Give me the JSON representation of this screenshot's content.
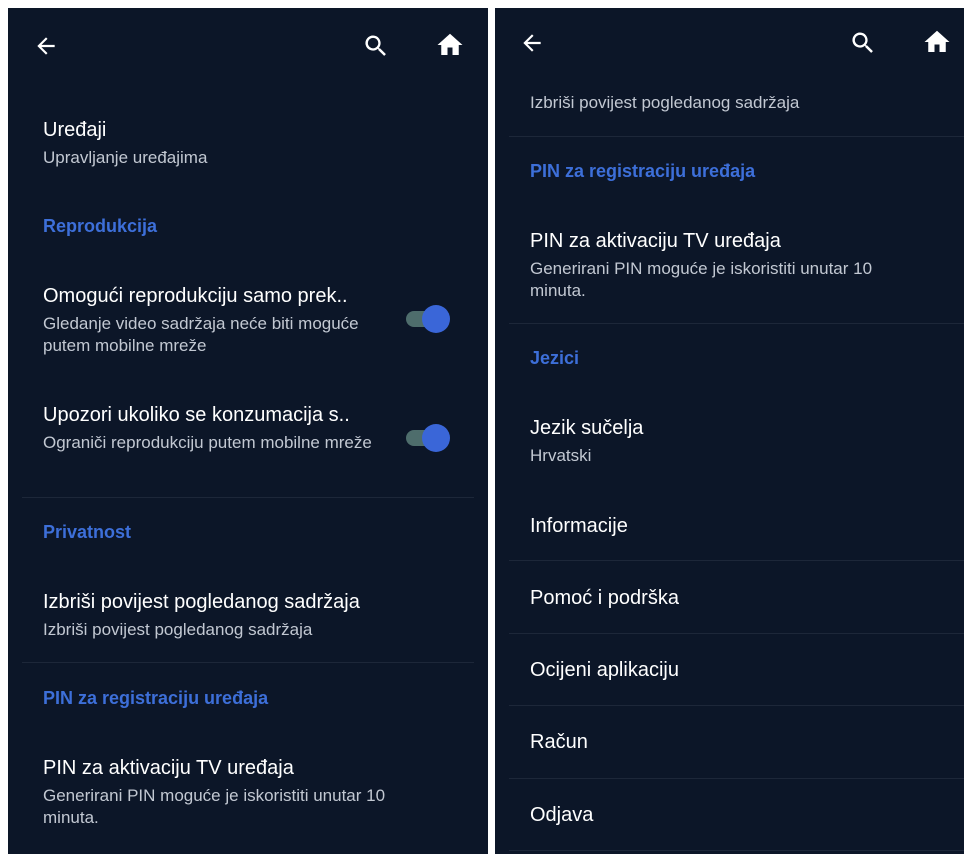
{
  "left": {
    "devices": {
      "title": "Uređaji",
      "subtitle": "Upravljanje uređajima"
    },
    "section_playback": "Reprodukcija",
    "wifi_only": {
      "title": "Omogući reprodukciju samo prek..",
      "subtitle": "Gledanje video sadržaja neće biti moguće putem mobilne mreže",
      "enabled": true
    },
    "warn_consumption": {
      "title": "Upozori ukoliko se konzumacija s..",
      "subtitle": "Ograniči reprodukciju putem mobilne mreže",
      "enabled": true
    },
    "section_privacy": "Privatnost",
    "clear_history": {
      "title": "Izbriši povijest pogledanog sadržaja",
      "subtitle": "Izbriši povijest pogledanog sadržaja"
    },
    "section_pin": "PIN za registraciju uređaja",
    "tv_pin": {
      "title": "PIN za aktivaciju TV uređaja",
      "subtitle": "Generirani PIN moguće je iskoristiti unutar 10 minuta."
    }
  },
  "right": {
    "clear_history_subtitle": "Izbriši povijest pogledanog sadržaja",
    "section_pin": "PIN za registraciju uređaja",
    "tv_pin": {
      "title": "PIN za aktivaciju TV uređaja",
      "subtitle": "Generirani PIN moguće je iskoristiti unutar 10 minuta."
    },
    "section_languages": "Jezici",
    "ui_language": {
      "title": "Jezik sučelja",
      "subtitle": "Hrvatski"
    },
    "info": "Informacije",
    "help": "Pomoć i podrška",
    "rate": "Ocijeni aplikaciju",
    "account": "Račun",
    "logout": "Odjava"
  },
  "icons": {
    "back": "arrow-left-icon",
    "search": "search-icon",
    "home": "home-icon"
  },
  "colors": {
    "background": "#0c1628",
    "accent": "#3d6fd9",
    "toggle_knob": "#3a66d8",
    "toggle_track": "#4e6d6c"
  }
}
